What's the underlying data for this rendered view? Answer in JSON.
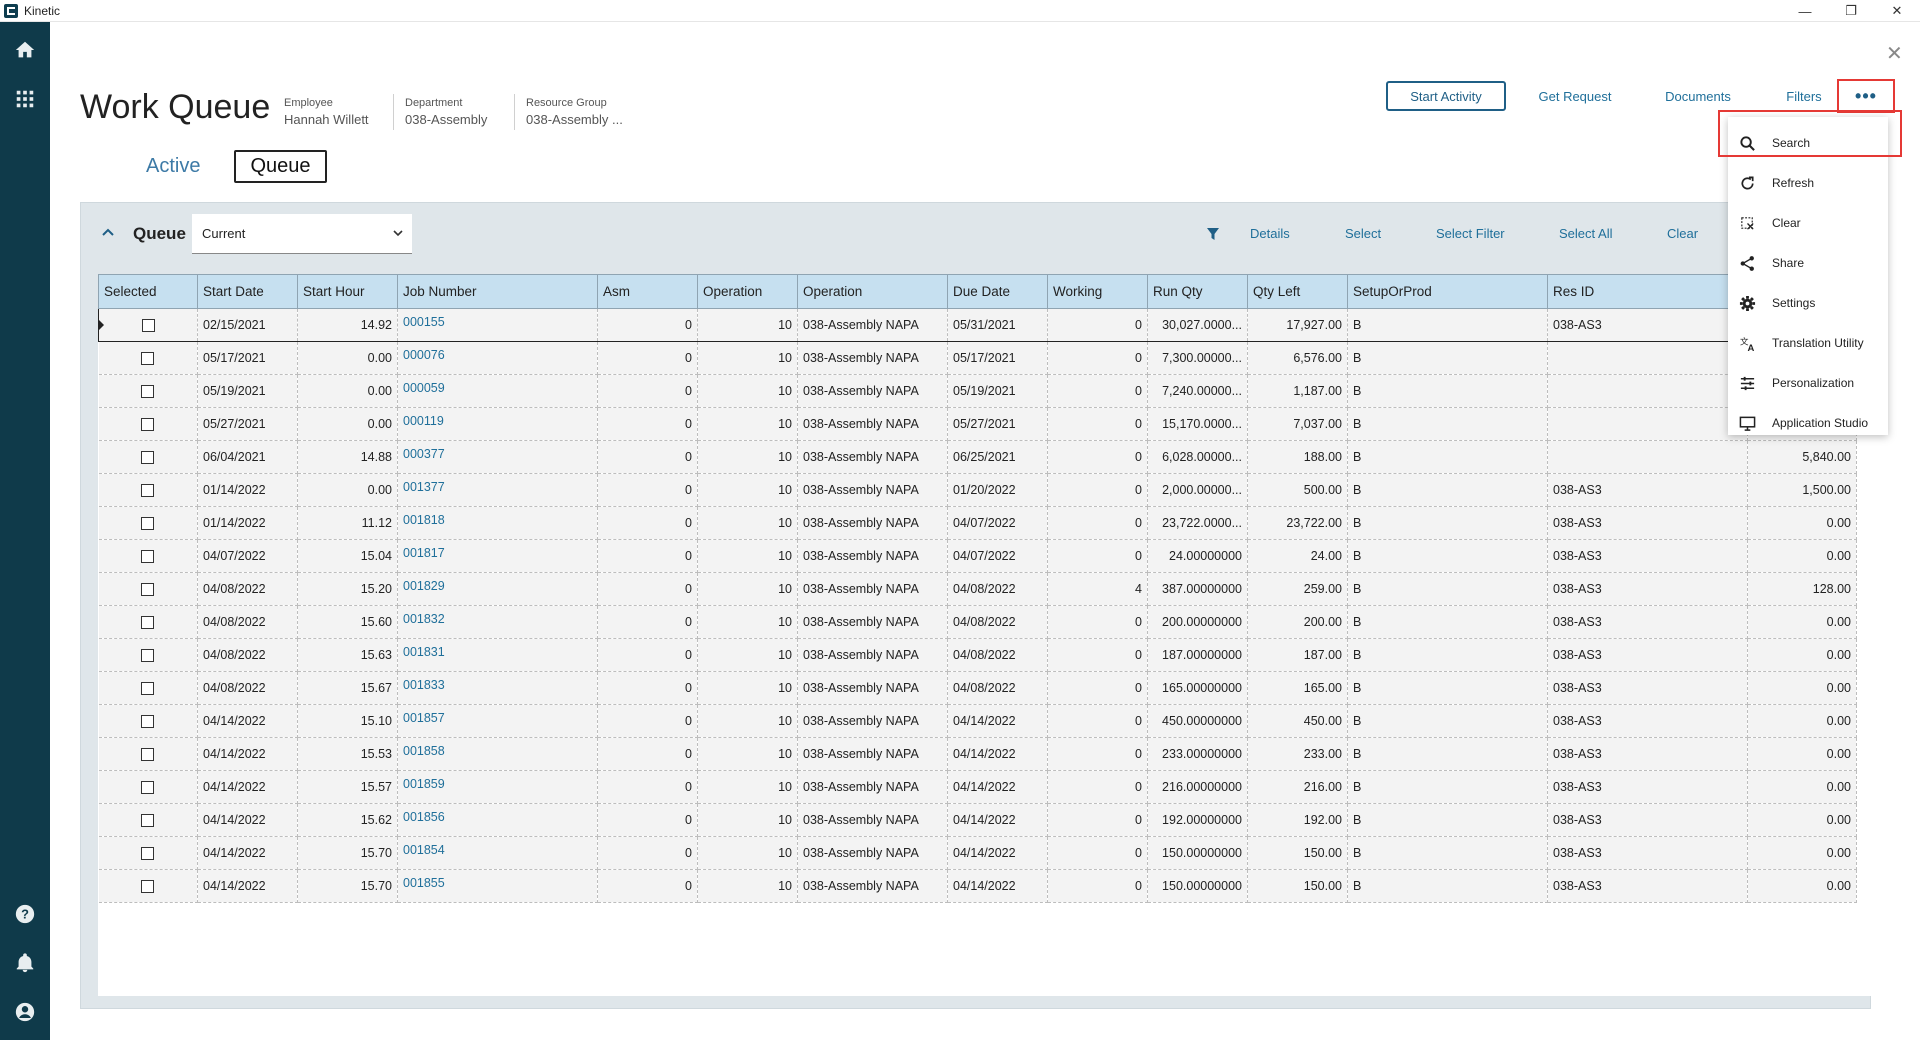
{
  "app": {
    "title": "Kinetic"
  },
  "window_controls": {
    "minimize": "—",
    "restore": "❐",
    "close": "✕"
  },
  "header": {
    "title": "Work Queue",
    "meta": [
      {
        "label": "Employee",
        "value": "Hannah Willett"
      },
      {
        "label": "Department",
        "value": "038-Assembly"
      },
      {
        "label": "Resource Group",
        "value": "038-Assembly ..."
      }
    ],
    "buttons": {
      "start_activity": "Start Activity",
      "get_request": "Get Request",
      "documents": "Documents",
      "filters": "Filters",
      "overflow": "•••",
      "close": "✕"
    }
  },
  "tabs": [
    {
      "label": "Active",
      "active": false
    },
    {
      "label": "Queue",
      "active": true
    }
  ],
  "panel": {
    "title": "Queue",
    "dropdown_value": "Current",
    "toolbar": {
      "details": "Details",
      "select": "Select",
      "select_filter": "Select Filter",
      "select_all": "Select All",
      "clear": "Clear"
    }
  },
  "grid": {
    "columns": [
      "Selected",
      "Start Date",
      "Start Hour",
      "Job Number",
      "Asm",
      "Operation",
      "Operation",
      "Due Date",
      "Working",
      "Run Qty",
      "Qty Left",
      "SetupOrProd",
      "Res ID",
      ""
    ],
    "rows": [
      [
        "02/15/2021",
        "14.92",
        "000155",
        "0",
        "10",
        "038-Assembly NAPA",
        "05/31/2021",
        "0",
        "30,027.0000...",
        "17,927.00",
        "B",
        "038-AS3",
        ""
      ],
      [
        "05/17/2021",
        "0.00",
        "000076",
        "0",
        "10",
        "038-Assembly NAPA",
        "05/17/2021",
        "0",
        "7,300.00000...",
        "6,576.00",
        "B",
        "",
        ""
      ],
      [
        "05/19/2021",
        "0.00",
        "000059",
        "0",
        "10",
        "038-Assembly NAPA",
        "05/19/2021",
        "0",
        "7,240.00000...",
        "1,187.00",
        "B",
        "",
        ""
      ],
      [
        "05/27/2021",
        "0.00",
        "000119",
        "0",
        "10",
        "038-Assembly NAPA",
        "05/27/2021",
        "0",
        "15,170.0000...",
        "7,037.00",
        "B",
        "",
        ""
      ],
      [
        "06/04/2021",
        "14.88",
        "000377",
        "0",
        "10",
        "038-Assembly NAPA",
        "06/25/2021",
        "0",
        "6,028.00000...",
        "188.00",
        "B",
        "",
        "5,840.00"
      ],
      [
        "01/14/2022",
        "0.00",
        "001377",
        "0",
        "10",
        "038-Assembly NAPA",
        "01/20/2022",
        "0",
        "2,000.00000...",
        "500.00",
        "B",
        "038-AS3",
        "1,500.00"
      ],
      [
        "01/14/2022",
        "11.12",
        "001818",
        "0",
        "10",
        "038-Assembly NAPA",
        "04/07/2022",
        "0",
        "23,722.0000...",
        "23,722.00",
        "B",
        "038-AS3",
        "0.00"
      ],
      [
        "04/07/2022",
        "15.04",
        "001817",
        "0",
        "10",
        "038-Assembly NAPA",
        "04/07/2022",
        "0",
        "24.00000000",
        "24.00",
        "B",
        "038-AS3",
        "0.00"
      ],
      [
        "04/08/2022",
        "15.20",
        "001829",
        "0",
        "10",
        "038-Assembly NAPA",
        "04/08/2022",
        "4",
        "387.00000000",
        "259.00",
        "B",
        "038-AS3",
        "128.00"
      ],
      [
        "04/08/2022",
        "15.60",
        "001832",
        "0",
        "10",
        "038-Assembly NAPA",
        "04/08/2022",
        "0",
        "200.00000000",
        "200.00",
        "B",
        "038-AS3",
        "0.00"
      ],
      [
        "04/08/2022",
        "15.63",
        "001831",
        "0",
        "10",
        "038-Assembly NAPA",
        "04/08/2022",
        "0",
        "187.00000000",
        "187.00",
        "B",
        "038-AS3",
        "0.00"
      ],
      [
        "04/08/2022",
        "15.67",
        "001833",
        "0",
        "10",
        "038-Assembly NAPA",
        "04/08/2022",
        "0",
        "165.00000000",
        "165.00",
        "B",
        "038-AS3",
        "0.00"
      ],
      [
        "04/14/2022",
        "15.10",
        "001857",
        "0",
        "10",
        "038-Assembly NAPA",
        "04/14/2022",
        "0",
        "450.00000000",
        "450.00",
        "B",
        "038-AS3",
        "0.00"
      ],
      [
        "04/14/2022",
        "15.53",
        "001858",
        "0",
        "10",
        "038-Assembly NAPA",
        "04/14/2022",
        "0",
        "233.00000000",
        "233.00",
        "B",
        "038-AS3",
        "0.00"
      ],
      [
        "04/14/2022",
        "15.57",
        "001859",
        "0",
        "10",
        "038-Assembly NAPA",
        "04/14/2022",
        "0",
        "216.00000000",
        "216.00",
        "B",
        "038-AS3",
        "0.00"
      ],
      [
        "04/14/2022",
        "15.62",
        "001856",
        "0",
        "10",
        "038-Assembly NAPA",
        "04/14/2022",
        "0",
        "192.00000000",
        "192.00",
        "B",
        "038-AS3",
        "0.00"
      ],
      [
        "04/14/2022",
        "15.70",
        "001854",
        "0",
        "10",
        "038-Assembly NAPA",
        "04/14/2022",
        "0",
        "150.00000000",
        "150.00",
        "B",
        "038-AS3",
        "0.00"
      ],
      [
        "04/14/2022",
        "15.70",
        "001855",
        "0",
        "10",
        "038-Assembly NAPA",
        "04/14/2022",
        "0",
        "150.00000000",
        "150.00",
        "B",
        "038-AS3",
        "0.00"
      ]
    ]
  },
  "menu": {
    "items": [
      {
        "label": "Search",
        "icon": "search-icon"
      },
      {
        "label": "Refresh",
        "icon": "refresh-icon"
      },
      {
        "label": "Clear",
        "icon": "clear-icon"
      },
      {
        "label": "Share",
        "icon": "share-icon"
      },
      {
        "label": "Settings",
        "icon": "gear-icon"
      },
      {
        "label": "Translation Utility",
        "icon": "translate-icon"
      },
      {
        "label": "Personalization",
        "icon": "sliders-icon"
      },
      {
        "label": "Application Studio",
        "icon": "monitor-icon"
      }
    ]
  },
  "colors": {
    "nav_bg": "#0f3a4a",
    "accent": "#1f6f9a",
    "highlight": "#e53935",
    "grid_header": "#c6e0f0",
    "panel_bg": "#dfe6ea"
  }
}
